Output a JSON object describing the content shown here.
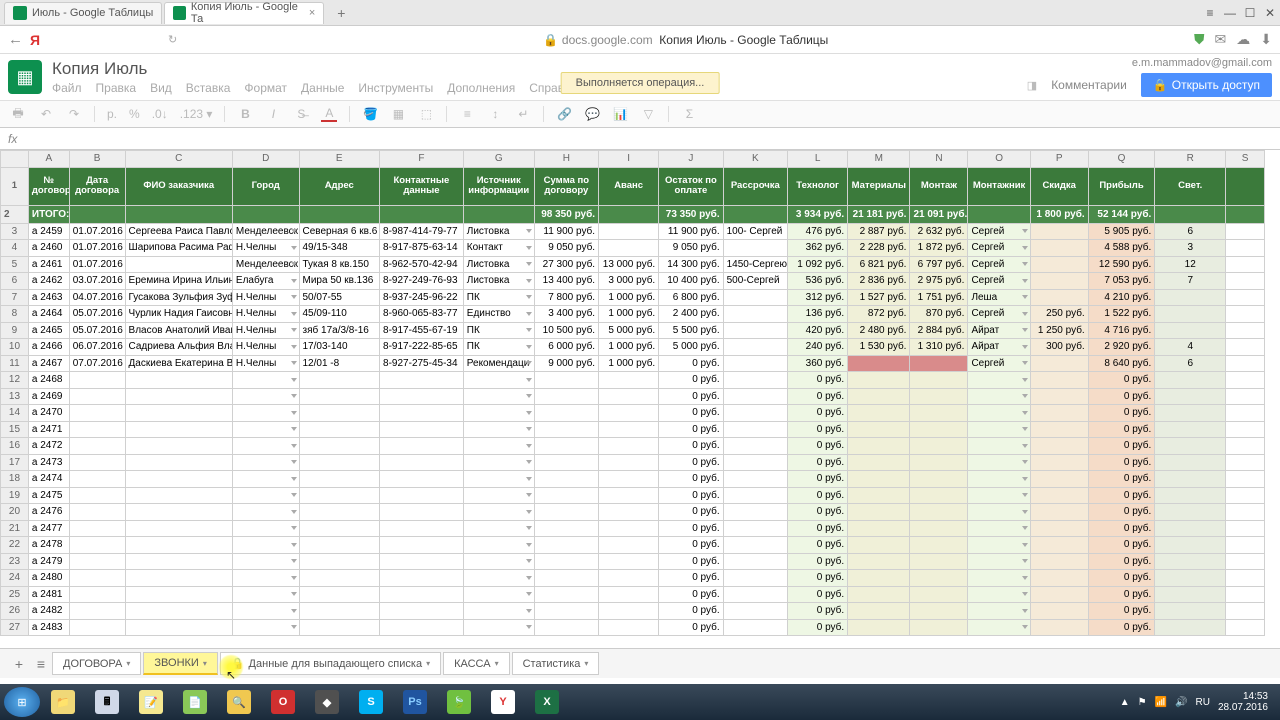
{
  "browser": {
    "tabs": [
      {
        "title": "Июль - Google Таблицы",
        "active": false
      },
      {
        "title": "Копия Июль - Google Та",
        "active": true
      }
    ],
    "url_host": "docs.google.com",
    "url_title": "Копия Июль - Google Таблицы"
  },
  "sheets": {
    "doc_title": "Копия Июль",
    "user_email": "e.m.mammadov@gmail.com",
    "menus": [
      "Файл",
      "Правка",
      "Вид",
      "Вставка",
      "Формат",
      "Данные",
      "Инструменты",
      "Дополнения",
      "Справка"
    ],
    "operation_msg": "Выполняется операция...",
    "comments_btn": "Комментарии",
    "share_btn": "Открыть доступ"
  },
  "toolbar": {
    "format_num": ".123 ▾"
  },
  "columns": [
    "A",
    "B",
    "C",
    "D",
    "E",
    "F",
    "G",
    "H",
    "I",
    "J",
    "K",
    "L",
    "M",
    "N",
    "O",
    "P",
    "Q",
    "R",
    "S"
  ],
  "headers": [
    "№ договора",
    "Дата договора",
    "ФИО заказчика",
    "Город",
    "Адрес",
    "Контактные данные",
    "Источник информации",
    "Сумма по договору",
    "Аванс",
    "Остаток по оплате",
    "Рассрочка",
    "Технолог",
    "Материалы",
    "Монтаж",
    "Монтажник",
    "Скидка",
    "Прибыль",
    "Свет.",
    ""
  ],
  "totals_label": "ИТОГО:",
  "totals": {
    "H": "98 350 руб.",
    "J": "73 350 руб.",
    "L": "3 934 руб.",
    "M": "21 181 руб.",
    "N": "21 091 руб.",
    "P": "1 800 руб.",
    "Q": "52 144 руб."
  },
  "rows": [
    {
      "n": 3,
      "a": "а 2459",
      "b": "01.07.2016",
      "c": "Сергеева Раиса Павло",
      "d": "Менделеевск",
      "e": "Северная 6 кв.6",
      "f": "8-987-414-79-77",
      "g": "Листовка",
      "h": "11 900 руб.",
      "i": "",
      "j": "11 900 руб.",
      "k": "100- Сергей",
      "l": "476 руб.",
      "m": "2 887 руб.",
      "n2": "2 632 руб.",
      "o": "Сергей",
      "p": "",
      "q": "5 905 руб.",
      "r": "6"
    },
    {
      "n": 4,
      "a": "а 2460",
      "b": "01.07.2016",
      "c": "Шарипова Расима Раф",
      "d": "Н.Челны",
      "e": "49/15-348",
      "f": "8-917-875-63-14",
      "g": "Контакт",
      "h": "9 050 руб.",
      "i": "",
      "j": "9 050 руб.",
      "k": "",
      "l": "362 руб.",
      "m": "2 228 руб.",
      "n2": "1 872 руб.",
      "o": "Сергей",
      "p": "",
      "q": "4 588 руб.",
      "r": "3"
    },
    {
      "n": 5,
      "a": "а 2461",
      "b": "01.07.2016",
      "c": "",
      "d": "Менделеевск",
      "e": "Тукая 8 кв.150",
      "f": "8-962-570-42-94",
      "g": "Листовка",
      "h": "27 300 руб.",
      "i": "13 000 руб.",
      "j": "14 300 руб.",
      "k": "1450-Сергею",
      "l": "1 092 руб.",
      "m": "6 821 руб.",
      "n2": "6 797 руб.",
      "o": "Сергей",
      "p": "",
      "q": "12 590 руб.",
      "r": "12"
    },
    {
      "n": 6,
      "a": "а 2462",
      "b": "03.07.2016",
      "c": "Еремина Ирина Ильин",
      "d": "Елабуга",
      "e": "Мира 50 кв.136",
      "f": "8-927-249-76-93",
      "g": "Листовка",
      "h": "13 400 руб.",
      "i": "3 000 руб.",
      "j": "10 400 руб.",
      "k": "500-Сергей",
      "l": "536 руб.",
      "m": "2 836 руб.",
      "n2": "2 975 руб.",
      "o": "Сергей",
      "p": "",
      "q": "7 053 руб.",
      "r": "7"
    },
    {
      "n": 7,
      "a": "а 2463",
      "b": "04.07.2016",
      "c": "Гусакова Зульфия Зуф",
      "d": "Н.Челны",
      "e": "50/07-55",
      "f": "8-937-245-96-22",
      "g": "ПК",
      "h": "7 800 руб.",
      "i": "1 000 руб.",
      "j": "6 800 руб.",
      "k": "",
      "l": "312 руб.",
      "m": "1 527 руб.",
      "n2": "1 751 руб.",
      "o": "Леша",
      "p": "",
      "q": "4 210 руб.",
      "r": ""
    },
    {
      "n": 8,
      "a": "а 2464",
      "b": "05.07.2016",
      "c": "Чурлик Надия Гаисовн",
      "d": "Н.Челны",
      "e": "45/09-110",
      "f": "8-960-065-83-77",
      "g": "Единство",
      "h": "3 400 руб.",
      "i": "1 000 руб.",
      "j": "2 400 руб.",
      "k": "",
      "l": "136 руб.",
      "m": "872 руб.",
      "n2": "870 руб.",
      "o": "Сергей",
      "p": "250 руб.",
      "q": "1 522 руб.",
      "r": ""
    },
    {
      "n": 9,
      "a": "а 2465",
      "b": "05.07.2016",
      "c": "Власов Анатолий Иван",
      "d": "Н.Челны",
      "e": "зяб 17а/3/8-16",
      "f": "8-917-455-67-19",
      "g": "ПК",
      "h": "10 500 руб.",
      "i": "5 000 руб.",
      "j": "5 500 руб.",
      "k": "",
      "l": "420 руб.",
      "m": "2 480 руб.",
      "n2": "2 884 руб.",
      "o": "Айрат",
      "p": "1 250 руб.",
      "q": "4 716 руб.",
      "r": ""
    },
    {
      "n": 10,
      "a": "а 2466",
      "b": "06.07.2016",
      "c": "Садриева Альфия Вла,",
      "d": "Н.Челны",
      "e": "17/03-140",
      "f": "8-917-222-85-65",
      "g": "ПК",
      "h": "6 000 руб.",
      "i": "1 000 руб.",
      "j": "5 000 руб.",
      "k": "",
      "l": "240 руб.",
      "m": "1 530 руб.",
      "n2": "1 310 руб.",
      "o": "Айрат",
      "p": "300 руб.",
      "q": "2 920 руб.",
      "r": "4"
    },
    {
      "n": 11,
      "a": "а 2467",
      "b": "07.07.2016",
      "c": "Даскиева Екатерина В",
      "d": "Н.Челны",
      "e": "12/01 -8",
      "f": "8-927-275-45-34",
      "g": "Рекомендаци",
      "h": "9 000 руб.",
      "i": "1 000 руб.",
      "j": "0 руб.",
      "k": "",
      "l": "360 руб.",
      "m": "",
      "n2": "",
      "o": "Сергей",
      "p": "",
      "q": "8 640 руб.",
      "r": "6",
      "red": true
    }
  ],
  "empty_rows": [
    {
      "n": 12,
      "a": "а 2468"
    },
    {
      "n": 13,
      "a": "а 2469"
    },
    {
      "n": 14,
      "a": "а 2470"
    },
    {
      "n": 15,
      "a": "а 2471"
    },
    {
      "n": 16,
      "a": "а 2472"
    },
    {
      "n": 17,
      "a": "а 2473"
    },
    {
      "n": 18,
      "a": "а 2474"
    },
    {
      "n": 19,
      "a": "а 2475"
    },
    {
      "n": 20,
      "a": "а 2476"
    },
    {
      "n": 21,
      "a": "а 2477"
    },
    {
      "n": 22,
      "a": "а 2478"
    },
    {
      "n": 23,
      "a": "а 2479"
    },
    {
      "n": 24,
      "a": "а 2480"
    },
    {
      "n": 25,
      "a": "а 2481"
    },
    {
      "n": 26,
      "a": "а 2482"
    },
    {
      "n": 27,
      "a": "а 2483"
    }
  ],
  "empty_j": "0 руб.",
  "empty_l": "0 руб.",
  "empty_q": "0 руб.",
  "sheet_tabs": [
    {
      "label": "ДОГОВОРА",
      "active": false
    },
    {
      "label": "ЗВОНКИ",
      "active": true
    },
    {
      "label": "Данные для выпадающего списка",
      "locked": true
    },
    {
      "label": "КАССА"
    },
    {
      "label": "Статистика"
    }
  ],
  "tray": {
    "time": "14:53",
    "date": "28.07.2016"
  }
}
